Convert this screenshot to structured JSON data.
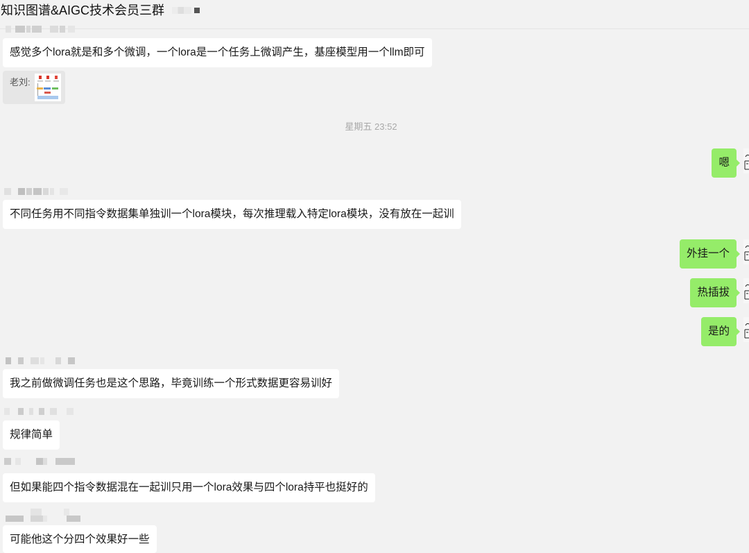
{
  "header": {
    "title": "知识图谱&AIGC技术会员三群"
  },
  "colors": {
    "background": "#f2f2f2",
    "received_bubble": "#ffffff",
    "sent_bubble": "#95ec69",
    "quote_bubble": "#e6e6e6",
    "timestamp_text": "#a8a8a8"
  },
  "conversation": [
    {
      "text": "感觉多个lora就是和多个微调，一个lora是一个任务上微调产生，基座模型用一个llm即可"
    },
    {
      "quote_label": "老刘:"
    },
    {
      "time": "星期五 23:52"
    },
    {
      "text": "嗯"
    },
    {
      "text": "不同任务用不同指令数据集单独训一个lora模块，每次推理载入特定lora模块，没有放在一起训"
    },
    {
      "text": "外挂一个"
    },
    {
      "text": "热插拔"
    },
    {
      "text": "是的"
    },
    {
      "text": "我之前做微调任务也是这个思路，毕竟训练一个形式数据更容易训好"
    },
    {
      "text": "规律简单"
    },
    {
      "text": "但如果能四个指令数据混在一起训只用一个lora效果与四个lora持平也挺好的"
    },
    {
      "text": "可能他这个分四个效果好一些"
    }
  ]
}
